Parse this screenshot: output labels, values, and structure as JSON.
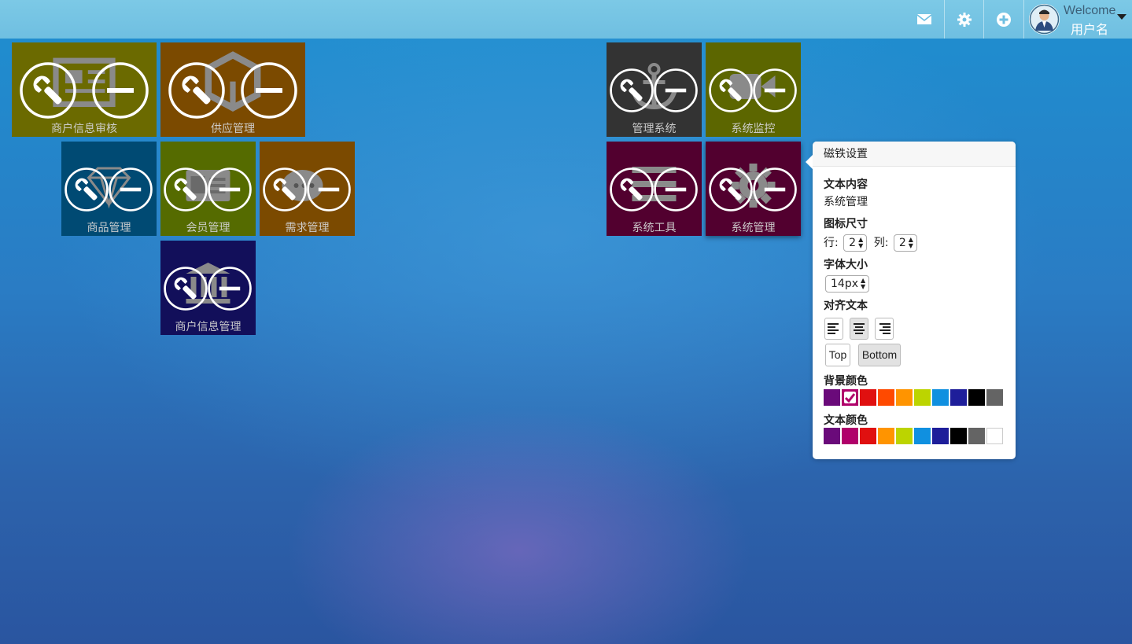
{
  "header": {
    "icons": [
      "mail-icon",
      "gear-icon",
      "plus-circle-icon"
    ],
    "welcome": "Welcome",
    "username": "用户名"
  },
  "tiles": [
    {
      "label": "商户信息审核",
      "color": "#6b6a00",
      "icon": "newspaper-icon"
    },
    {
      "label": "供应管理",
      "color": "#7b4a00",
      "icon": "cubes-icon"
    },
    {
      "label": "商品管理",
      "color": "#004a73",
      "icon": "diamond-icon"
    },
    {
      "label": "会员管理",
      "color": "#556b00",
      "icon": "id-card-icon"
    },
    {
      "label": "需求管理",
      "color": "#7b4a00",
      "icon": "comments-icon"
    },
    {
      "label": "商户信息管理",
      "color": "#120f5a",
      "icon": "bank-icon"
    },
    {
      "label": "管理系统",
      "color": "#333333",
      "icon": "anchor-icon"
    },
    {
      "label": "系统监控",
      "color": "#5c6600",
      "icon": "video-camera-icon"
    },
    {
      "label": "系统工具",
      "color": "#52002f",
      "icon": "list-icon"
    },
    {
      "label": "系统管理",
      "color": "#52002f",
      "icon": "gear-icon"
    }
  ],
  "settings_panel": {
    "title": "磁铁设置",
    "text_content_label": "文本内容",
    "text_content_value": "系统管理",
    "icon_size_label": "图标尺寸",
    "row_label": "行:",
    "row_value": "2",
    "col_label": "列:",
    "col_value": "2",
    "font_size_label": "字体大小",
    "font_size_value": "14px",
    "align_label": "对齐文本",
    "align_options": [
      "align-left",
      "align-center",
      "align-right"
    ],
    "align_selected": "align-center",
    "position_top": "Top",
    "position_bottom": "Bottom",
    "position_selected": "Bottom",
    "bg_color_label": "背景颜色",
    "bg_colors": [
      "#6a0a7a",
      "#b0006a",
      "#e01010",
      "#ff4a00",
      "#ff9400",
      "#bcd400",
      "#1090e0",
      "#1e1e9a",
      "#000000",
      "#646464"
    ],
    "bg_color_selected": "#b0006a",
    "text_color_label": "文本颜色",
    "text_colors": [
      "#6a0a7a",
      "#b0006a",
      "#e01010",
      "#ff9400",
      "#bcd400",
      "#1090e0",
      "#1e1e9a",
      "#000000",
      "#646464",
      "#ffffff"
    ]
  }
}
